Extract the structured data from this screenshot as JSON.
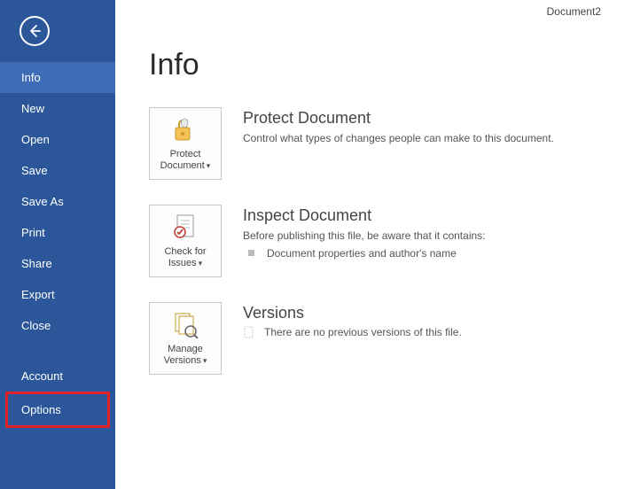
{
  "docTitle": "Document2",
  "pageTitle": "Info",
  "nav": {
    "info": "Info",
    "new": "New",
    "open": "Open",
    "save": "Save",
    "saveAs": "Save As",
    "print": "Print",
    "share": "Share",
    "export": "Export",
    "close": "Close",
    "account": "Account",
    "options": "Options"
  },
  "protect": {
    "btn1": "Protect",
    "btn2": "Document",
    "title": "Protect Document",
    "desc": "Control what types of changes people can make to this document."
  },
  "inspect": {
    "btn1": "Check for",
    "btn2": "Issues",
    "title": "Inspect Document",
    "desc": "Before publishing this file, be aware that it contains:",
    "item": "Document properties and author's name"
  },
  "versions": {
    "btn1": "Manage",
    "btn2": "Versions",
    "title": "Versions",
    "desc": "There are no previous versions of this file."
  }
}
